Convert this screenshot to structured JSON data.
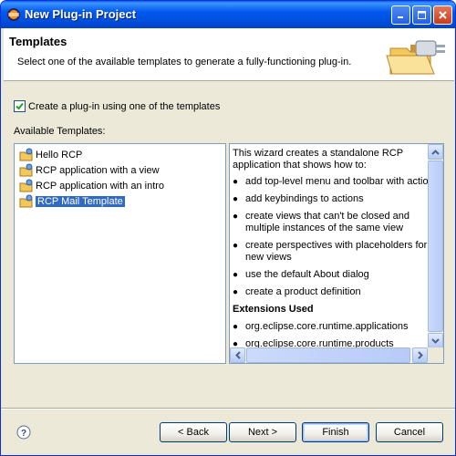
{
  "window": {
    "title": "New Plug-in Project"
  },
  "banner": {
    "title": "Templates",
    "description": "Select one of the available templates to generate a fully-functioning plug-in."
  },
  "checkbox": {
    "checked": true,
    "label": "Create a plug-in using one of the templates"
  },
  "available_label": "Available Templates:",
  "templates": [
    {
      "label": "Hello RCP",
      "selected": false
    },
    {
      "label": "RCP application with a view",
      "selected": false
    },
    {
      "label": "RCP application with an intro",
      "selected": false
    },
    {
      "label": "RCP Mail Template",
      "selected": true
    }
  ],
  "description": {
    "intro": "This wizard creates a standalone RCP application that shows how to:",
    "bullets": [
      "add top-level menu and toolbar with actio",
      "add keybindings to actions",
      "create views that can't be closed and multiple instances of the same view",
      "create perspectives with placeholders for new views",
      "use the default About dialog",
      "create a product definition"
    ],
    "extensions_heading": "Extensions Used",
    "extensions": [
      "org.eclipse.core.runtime.applications",
      "org.eclipse.core.runtime.products"
    ]
  },
  "buttons": {
    "back": "< Back",
    "next": "Next >",
    "finish": "Finish",
    "cancel": "Cancel"
  },
  "icons": {
    "title": "eclipse-icon",
    "banner": "plugin-folder-icon",
    "template": "template-icon",
    "help": "help-icon"
  },
  "colors": {
    "titlebar": "#0054e3",
    "selection": "#316ac5",
    "dialog_bg": "#ece9d8"
  }
}
